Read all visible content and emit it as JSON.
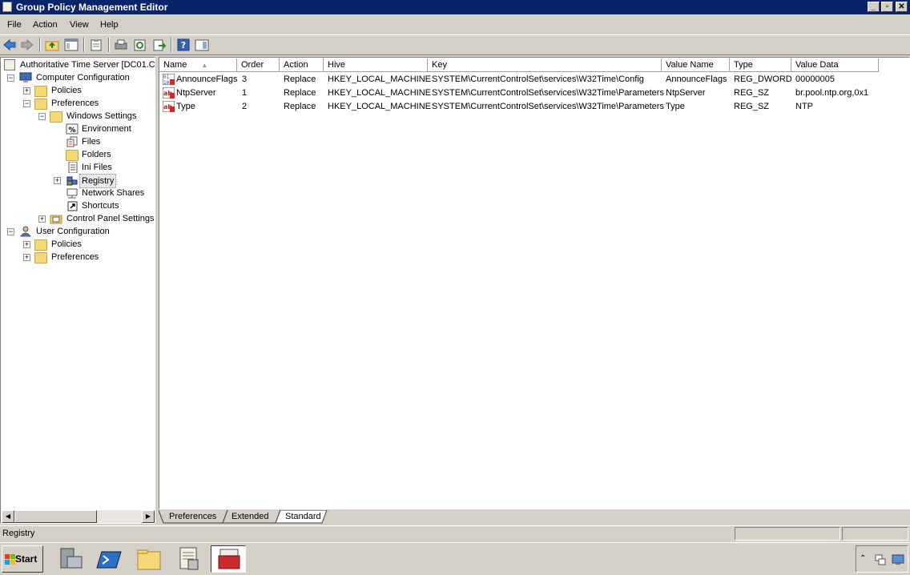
{
  "window": {
    "title": "Group Policy Management Editor",
    "min": "_",
    "max": "▫",
    "close": "✕"
  },
  "menu": [
    "File",
    "Action",
    "View",
    "Help"
  ],
  "tree": {
    "root": "Authoritative Time Server [DC01.C",
    "computer_config": "Computer Configuration",
    "policies": "Policies",
    "preferences": "Preferences",
    "windows_settings": "Windows Settings",
    "environment": "Environment",
    "files": "Files",
    "folders": "Folders",
    "ini_files": "Ini Files",
    "registry": "Registry",
    "network_shares": "Network Shares",
    "shortcuts": "Shortcuts",
    "control_panel": "Control Panel Settings",
    "user_config": "User Configuration",
    "user_policies": "Policies",
    "user_preferences": "Preferences"
  },
  "list": {
    "columns": [
      "Name",
      "Order",
      "Action",
      "Hive",
      "Key",
      "Value Name",
      "Type",
      "Value Data"
    ],
    "rows": [
      {
        "name": "AnnounceFlags",
        "order": "3",
        "action": "Replace",
        "hive": "HKEY_LOCAL_MACHINE",
        "key": "SYSTEM\\CurrentControlSet\\services\\W32Time\\Config",
        "value_name": "AnnounceFlags",
        "type": "REG_DWORD",
        "value_data": "00000005"
      },
      {
        "name": "NtpServer",
        "order": "1",
        "action": "Replace",
        "hive": "HKEY_LOCAL_MACHINE",
        "key": "SYSTEM\\CurrentControlSet\\services\\W32Time\\Parameters",
        "value_name": "NtpServer",
        "type": "REG_SZ",
        "value_data": "br.pool.ntp.org,0x1"
      },
      {
        "name": "Type",
        "order": "2",
        "action": "Replace",
        "hive": "HKEY_LOCAL_MACHINE",
        "key": "SYSTEM\\CurrentControlSet\\services\\W32Time\\Parameters",
        "value_name": "Type",
        "type": "REG_SZ",
        "value_data": "NTP"
      }
    ]
  },
  "tabs": [
    "Preferences",
    "Extended",
    "Standard"
  ],
  "status": {
    "text": "Registry"
  },
  "taskbar": {
    "start": "Start"
  },
  "colors": {
    "titlebar": "#0a246a",
    "face": "#d4d0c8",
    "folder": "#f5d777"
  }
}
